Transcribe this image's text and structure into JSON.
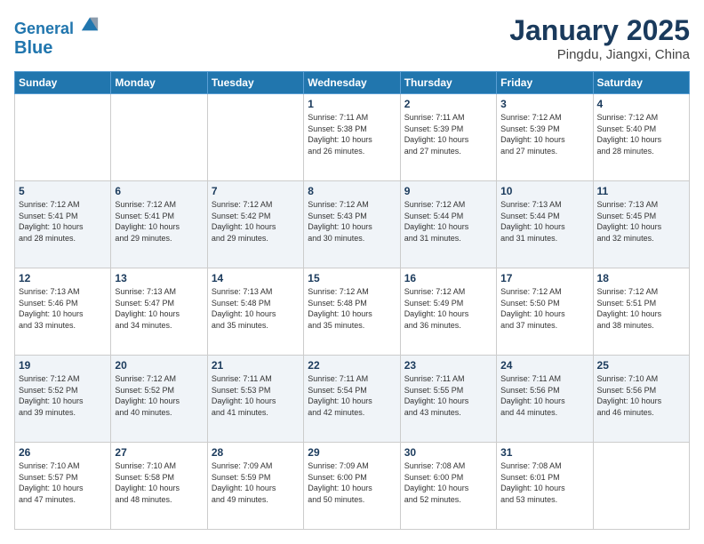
{
  "header": {
    "logo_line1": "General",
    "logo_line2": "Blue",
    "month": "January 2025",
    "location": "Pingdu, Jiangxi, China"
  },
  "days_of_week": [
    "Sunday",
    "Monday",
    "Tuesday",
    "Wednesday",
    "Thursday",
    "Friday",
    "Saturday"
  ],
  "weeks": [
    [
      {
        "day": "",
        "info": ""
      },
      {
        "day": "",
        "info": ""
      },
      {
        "day": "",
        "info": ""
      },
      {
        "day": "1",
        "info": "Sunrise: 7:11 AM\nSunset: 5:38 PM\nDaylight: 10 hours\nand 26 minutes."
      },
      {
        "day": "2",
        "info": "Sunrise: 7:11 AM\nSunset: 5:39 PM\nDaylight: 10 hours\nand 27 minutes."
      },
      {
        "day": "3",
        "info": "Sunrise: 7:12 AM\nSunset: 5:39 PM\nDaylight: 10 hours\nand 27 minutes."
      },
      {
        "day": "4",
        "info": "Sunrise: 7:12 AM\nSunset: 5:40 PM\nDaylight: 10 hours\nand 28 minutes."
      }
    ],
    [
      {
        "day": "5",
        "info": "Sunrise: 7:12 AM\nSunset: 5:41 PM\nDaylight: 10 hours\nand 28 minutes."
      },
      {
        "day": "6",
        "info": "Sunrise: 7:12 AM\nSunset: 5:41 PM\nDaylight: 10 hours\nand 29 minutes."
      },
      {
        "day": "7",
        "info": "Sunrise: 7:12 AM\nSunset: 5:42 PM\nDaylight: 10 hours\nand 29 minutes."
      },
      {
        "day": "8",
        "info": "Sunrise: 7:12 AM\nSunset: 5:43 PM\nDaylight: 10 hours\nand 30 minutes."
      },
      {
        "day": "9",
        "info": "Sunrise: 7:12 AM\nSunset: 5:44 PM\nDaylight: 10 hours\nand 31 minutes."
      },
      {
        "day": "10",
        "info": "Sunrise: 7:13 AM\nSunset: 5:44 PM\nDaylight: 10 hours\nand 31 minutes."
      },
      {
        "day": "11",
        "info": "Sunrise: 7:13 AM\nSunset: 5:45 PM\nDaylight: 10 hours\nand 32 minutes."
      }
    ],
    [
      {
        "day": "12",
        "info": "Sunrise: 7:13 AM\nSunset: 5:46 PM\nDaylight: 10 hours\nand 33 minutes."
      },
      {
        "day": "13",
        "info": "Sunrise: 7:13 AM\nSunset: 5:47 PM\nDaylight: 10 hours\nand 34 minutes."
      },
      {
        "day": "14",
        "info": "Sunrise: 7:13 AM\nSunset: 5:48 PM\nDaylight: 10 hours\nand 35 minutes."
      },
      {
        "day": "15",
        "info": "Sunrise: 7:12 AM\nSunset: 5:48 PM\nDaylight: 10 hours\nand 35 minutes."
      },
      {
        "day": "16",
        "info": "Sunrise: 7:12 AM\nSunset: 5:49 PM\nDaylight: 10 hours\nand 36 minutes."
      },
      {
        "day": "17",
        "info": "Sunrise: 7:12 AM\nSunset: 5:50 PM\nDaylight: 10 hours\nand 37 minutes."
      },
      {
        "day": "18",
        "info": "Sunrise: 7:12 AM\nSunset: 5:51 PM\nDaylight: 10 hours\nand 38 minutes."
      }
    ],
    [
      {
        "day": "19",
        "info": "Sunrise: 7:12 AM\nSunset: 5:52 PM\nDaylight: 10 hours\nand 39 minutes."
      },
      {
        "day": "20",
        "info": "Sunrise: 7:12 AM\nSunset: 5:52 PM\nDaylight: 10 hours\nand 40 minutes."
      },
      {
        "day": "21",
        "info": "Sunrise: 7:11 AM\nSunset: 5:53 PM\nDaylight: 10 hours\nand 41 minutes."
      },
      {
        "day": "22",
        "info": "Sunrise: 7:11 AM\nSunset: 5:54 PM\nDaylight: 10 hours\nand 42 minutes."
      },
      {
        "day": "23",
        "info": "Sunrise: 7:11 AM\nSunset: 5:55 PM\nDaylight: 10 hours\nand 43 minutes."
      },
      {
        "day": "24",
        "info": "Sunrise: 7:11 AM\nSunset: 5:56 PM\nDaylight: 10 hours\nand 44 minutes."
      },
      {
        "day": "25",
        "info": "Sunrise: 7:10 AM\nSunset: 5:56 PM\nDaylight: 10 hours\nand 46 minutes."
      }
    ],
    [
      {
        "day": "26",
        "info": "Sunrise: 7:10 AM\nSunset: 5:57 PM\nDaylight: 10 hours\nand 47 minutes."
      },
      {
        "day": "27",
        "info": "Sunrise: 7:10 AM\nSunset: 5:58 PM\nDaylight: 10 hours\nand 48 minutes."
      },
      {
        "day": "28",
        "info": "Sunrise: 7:09 AM\nSunset: 5:59 PM\nDaylight: 10 hours\nand 49 minutes."
      },
      {
        "day": "29",
        "info": "Sunrise: 7:09 AM\nSunset: 6:00 PM\nDaylight: 10 hours\nand 50 minutes."
      },
      {
        "day": "30",
        "info": "Sunrise: 7:08 AM\nSunset: 6:00 PM\nDaylight: 10 hours\nand 52 minutes."
      },
      {
        "day": "31",
        "info": "Sunrise: 7:08 AM\nSunset: 6:01 PM\nDaylight: 10 hours\nand 53 minutes."
      },
      {
        "day": "",
        "info": ""
      }
    ]
  ]
}
